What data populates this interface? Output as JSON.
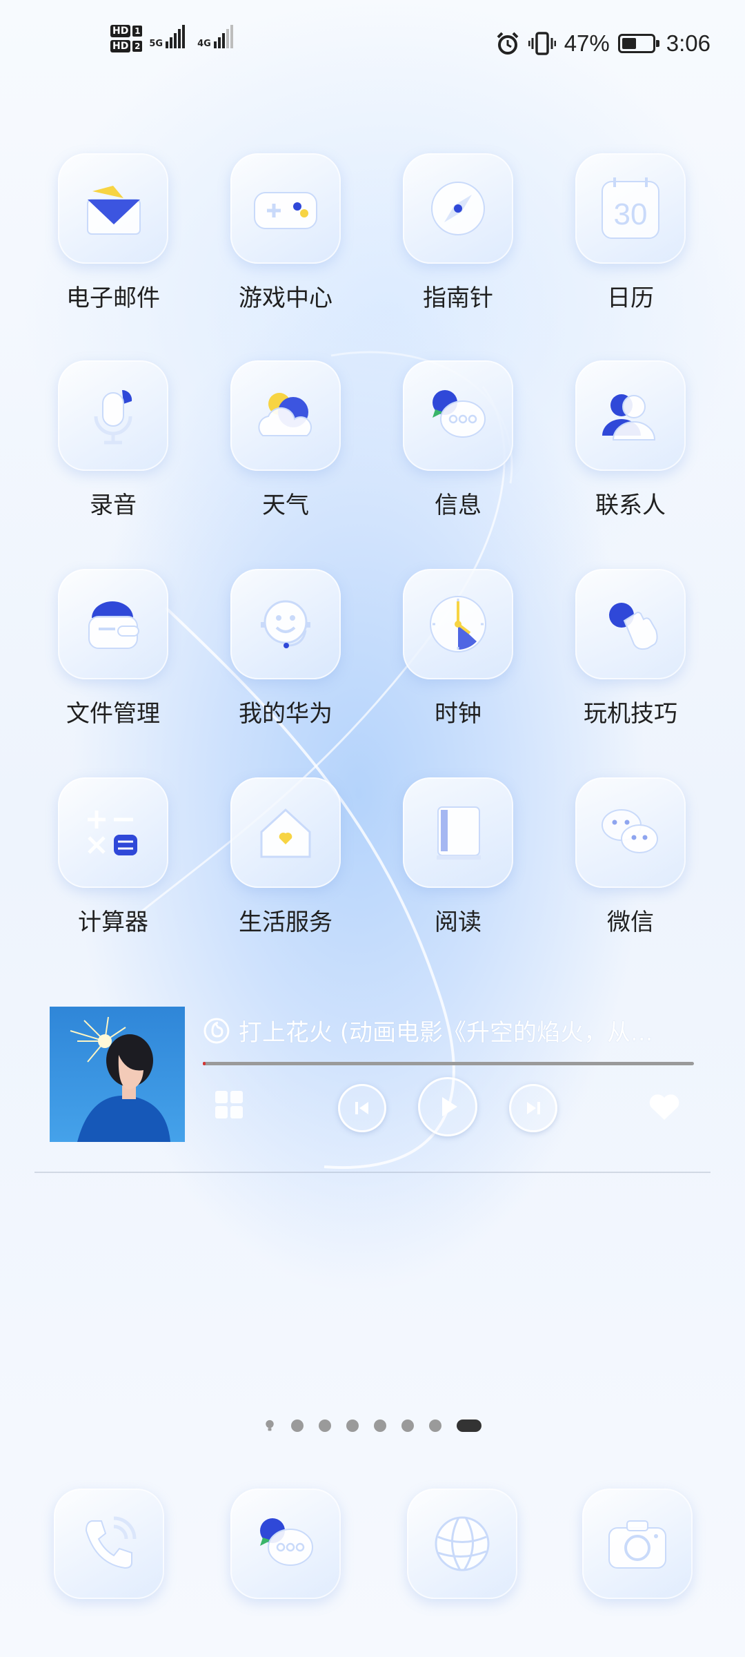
{
  "status_bar": {
    "sim1_badge": "HD",
    "sim1_num": "1",
    "sim2_badge": "HD",
    "sim2_num": "2",
    "sim1_network": "5G",
    "sim2_network": "4G",
    "battery_percent": "47%",
    "battery_level": 0.47,
    "time": "3:06",
    "icons": [
      "alarm-icon",
      "vibrate-icon",
      "battery-icon"
    ]
  },
  "apps": [
    {
      "label": "电子邮件",
      "icon": "email-icon"
    },
    {
      "label": "游戏中心",
      "icon": "gamepad-icon"
    },
    {
      "label": "指南针",
      "icon": "compass-icon"
    },
    {
      "label": "日历",
      "icon": "calendar-icon",
      "badge": "30"
    },
    {
      "label": "录音",
      "icon": "microphone-icon"
    },
    {
      "label": "天气",
      "icon": "weather-icon"
    },
    {
      "label": "信息",
      "icon": "messages-icon"
    },
    {
      "label": "联系人",
      "icon": "contacts-icon"
    },
    {
      "label": "文件管理",
      "icon": "folder-icon"
    },
    {
      "label": "我的华为",
      "icon": "smiley-headset-icon"
    },
    {
      "label": "时钟",
      "icon": "clock-icon"
    },
    {
      "label": "玩机技巧",
      "icon": "tips-hand-icon"
    },
    {
      "label": "计算器",
      "icon": "calculator-icon"
    },
    {
      "label": "生活服务",
      "icon": "home-heart-icon"
    },
    {
      "label": "阅读",
      "icon": "book-icon"
    },
    {
      "label": "微信",
      "icon": "wechat-icon"
    }
  ],
  "music_widget": {
    "song_title": "打上花火 (动画电影《升空的焰火，从...",
    "progress": 0.005,
    "icons": [
      "netease-music-icon",
      "playlist-icon",
      "previous-icon",
      "play-icon",
      "next-icon",
      "heart-icon"
    ]
  },
  "page_indicator": {
    "count": 8,
    "active_index": 7
  },
  "dock": [
    {
      "icon": "phone-icon"
    },
    {
      "icon": "messages-icon"
    },
    {
      "icon": "browser-globe-icon"
    },
    {
      "icon": "camera-icon"
    }
  ],
  "colors": {
    "accent_blue": "#2f48d8",
    "accent_yellow": "#f7d443",
    "tile_light": "#e4eefd"
  }
}
